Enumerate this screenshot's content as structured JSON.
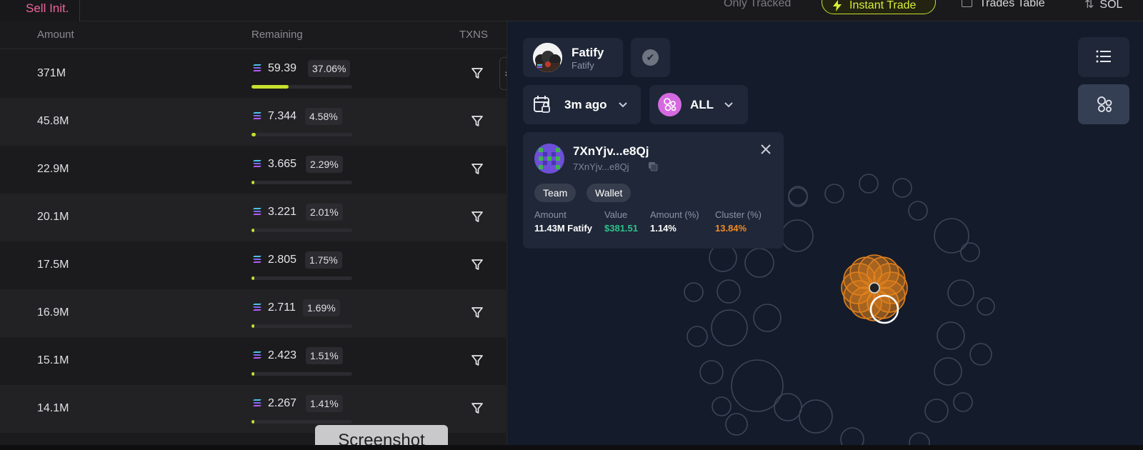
{
  "topbar": {
    "sell_init_label": "Sell Init.",
    "only_tracked_label": "Only Tracked",
    "instant_trade_label": "Instant Trade",
    "trades_table_label": "Trades Table",
    "currency_label": "SOL"
  },
  "table": {
    "headers": {
      "amount": "Amount",
      "remaining": "Remaining",
      "txns": "TXNS"
    },
    "rows": [
      {
        "amount": "371M",
        "remaining": "59.39",
        "pct": "37.06%",
        "fill": 0.3706
      },
      {
        "amount": "45.8M",
        "remaining": "7.344",
        "pct": "4.58%",
        "fill": 0.0458
      },
      {
        "amount": "22.9M",
        "remaining": "3.665",
        "pct": "2.29%",
        "fill": 0.0229
      },
      {
        "amount": "20.1M",
        "remaining": "3.221",
        "pct": "2.01%",
        "fill": 0.0201
      },
      {
        "amount": "17.5M",
        "remaining": "2.805",
        "pct": "1.75%",
        "fill": 0.0175
      },
      {
        "amount": "16.9M",
        "remaining": "2.711",
        "pct": "1.69%",
        "fill": 0.0169
      },
      {
        "amount": "15.1M",
        "remaining": "2.423",
        "pct": "1.51%",
        "fill": 0.0151
      },
      {
        "amount": "14.1M",
        "remaining": "2.267",
        "pct": "1.41%",
        "fill": 0.0141
      }
    ]
  },
  "bubblemap": {
    "token": {
      "name": "Fatify",
      "symbol": "Fatify"
    },
    "time_filter": "3m ago",
    "holder_filter": "ALL",
    "wallet": {
      "address": "7XnYjv...e8Qj",
      "address_short": "7XnYjv...e8Qj",
      "tags": [
        "Team",
        "Wallet"
      ],
      "stats": {
        "amount_label": "Amount",
        "amount_value": "11.43M Fatify",
        "value_label": "Value",
        "value_value": "$381.51",
        "amount_pct_label": "Amount (%)",
        "amount_pct_value": "1.14%",
        "cluster_pct_label": "Cluster (%)",
        "cluster_pct_value": "13.84%"
      }
    }
  },
  "overlay": {
    "screenshot_label": "Screenshot"
  },
  "colors": {
    "accent_lime": "#c7df2e",
    "sell_pink": "#f0649b",
    "value_green": "#2ec28a",
    "cluster_orange": "#f08a24",
    "cluster_bubble": "#e0801c"
  },
  "icons": [
    "bolt-icon",
    "table-icon",
    "swap-icon",
    "solana-icon",
    "filter-icon",
    "chevron-right-icon",
    "check-icon",
    "calendar-icon",
    "chevron-down-icon",
    "bubbles-icon",
    "list-icon",
    "graph-icon",
    "copy-icon",
    "close-icon"
  ]
}
